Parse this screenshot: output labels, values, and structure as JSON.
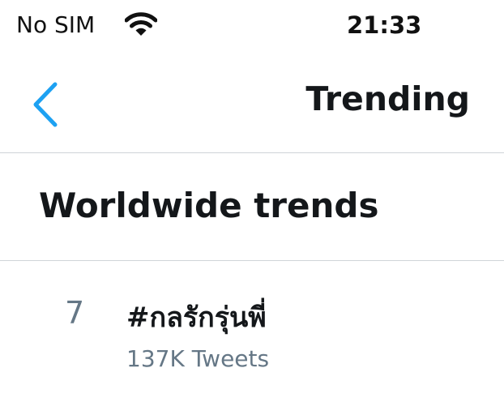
{
  "status_bar": {
    "carrier": "No SIM",
    "wifi_icon": "wifi-icon",
    "time": "21:33"
  },
  "nav": {
    "back_icon": "chevron-left-icon",
    "title": "Trending"
  },
  "section": {
    "title": "Worldwide trends"
  },
  "trends": [
    {
      "rank": "7",
      "name": "#กลรักรุ่นพี่",
      "tweet_count": "137K Tweets"
    }
  ],
  "colors": {
    "accent": "#1da1f2",
    "text_primary": "#14171a",
    "text_secondary": "#657786",
    "divider": "#cfd4d8"
  }
}
